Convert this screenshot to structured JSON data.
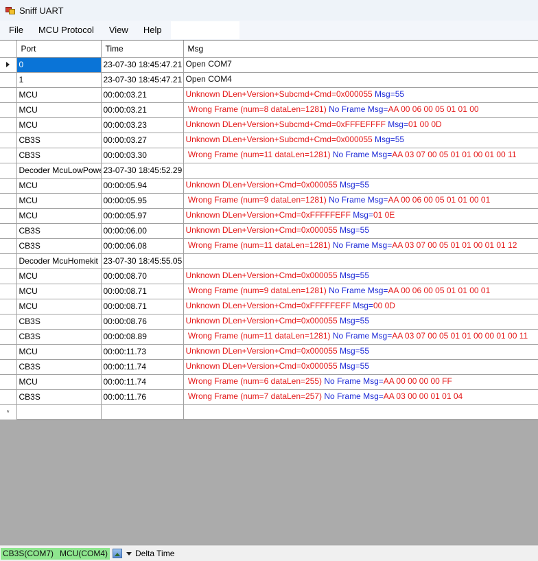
{
  "window": {
    "title": "Sniff UART"
  },
  "menu": {
    "file": "File",
    "mcu_protocol": "MCU Protocol",
    "view": "View",
    "help": "Help"
  },
  "grid": {
    "columns": {
      "port": "Port",
      "time": "Time",
      "msg": "Msg"
    },
    "rows": [
      {
        "port": "0",
        "time": "23-07-30 18:45:47.21",
        "parts": [
          {
            "text": "Open COM7",
            "color": "black"
          }
        ]
      },
      {
        "port": "1",
        "time": "23-07-30 18:45:47.21",
        "parts": [
          {
            "text": "Open COM4",
            "color": "black"
          }
        ]
      },
      {
        "port": "MCU",
        "time": "00:00:03.21",
        "parts": [
          {
            "text": "Unknown DLen+Version+Subcmd+Cmd=0x000055 ",
            "color": "red"
          },
          {
            "text": "Msg=55",
            "color": "blue"
          }
        ]
      },
      {
        "port": "MCU",
        "time": "00:00:03.21",
        "parts": [
          {
            "text": " Wrong Frame (num=8 dataLen=1281) ",
            "color": "red"
          },
          {
            "text": "No Frame Msg=",
            "color": "blue"
          },
          {
            "text": "AA 00 06 00 05 01 01 00",
            "color": "red"
          }
        ]
      },
      {
        "port": "MCU",
        "time": "00:00:03.23",
        "parts": [
          {
            "text": "Unknown DLen+Version+Subcmd+Cmd=0xFFFEFFFF ",
            "color": "red"
          },
          {
            "text": "Msg=",
            "color": "blue"
          },
          {
            "text": "01 00 0D",
            "color": "red"
          }
        ]
      },
      {
        "port": "CB3S",
        "time": "00:00:03.27",
        "parts": [
          {
            "text": "Unknown DLen+Version+Subcmd+Cmd=0x000055 ",
            "color": "red"
          },
          {
            "text": "Msg=55",
            "color": "blue"
          }
        ]
      },
      {
        "port": "CB3S",
        "time": "00:00:03.30",
        "parts": [
          {
            "text": " Wrong Frame (num=11 dataLen=1281) ",
            "color": "red"
          },
          {
            "text": "No Frame Msg=",
            "color": "blue"
          },
          {
            "text": "AA 03 07 00 05 01 01 00 01 00 11",
            "color": "red"
          }
        ]
      },
      {
        "port": "Decoder McuLowPower",
        "time": "23-07-30 18:45:52.29",
        "parts": []
      },
      {
        "port": "MCU",
        "time": "00:00:05.94",
        "parts": [
          {
            "text": "Unknown DLen+Version+Cmd=0x000055 ",
            "color": "red"
          },
          {
            "text": "Msg=55",
            "color": "blue"
          }
        ]
      },
      {
        "port": "MCU",
        "time": "00:00:05.95",
        "parts": [
          {
            "text": " Wrong Frame (num=9 dataLen=1281) ",
            "color": "red"
          },
          {
            "text": "No Frame Msg=",
            "color": "blue"
          },
          {
            "text": "AA 00 06 00 05 01 01 00 01",
            "color": "red"
          }
        ]
      },
      {
        "port": "MCU",
        "time": "00:00:05.97",
        "parts": [
          {
            "text": "Unknown DLen+Version+Cmd=0xFFFFFEFF ",
            "color": "red"
          },
          {
            "text": "Msg=",
            "color": "blue"
          },
          {
            "text": "01 0E",
            "color": "red"
          }
        ]
      },
      {
        "port": "CB3S",
        "time": "00:00:06.00",
        "parts": [
          {
            "text": "Unknown DLen+Version+Cmd=0x000055 ",
            "color": "red"
          },
          {
            "text": "Msg=55",
            "color": "blue"
          }
        ]
      },
      {
        "port": "CB3S",
        "time": "00:00:06.08",
        "parts": [
          {
            "text": " Wrong Frame (num=11 dataLen=1281) ",
            "color": "red"
          },
          {
            "text": "No Frame Msg=",
            "color": "blue"
          },
          {
            "text": "AA 03 07 00 05 01 01 00 01 01 12",
            "color": "red"
          }
        ]
      },
      {
        "port": "Decoder McuHomekit",
        "time": "23-07-30 18:45:55.05",
        "parts": []
      },
      {
        "port": "MCU",
        "time": "00:00:08.70",
        "parts": [
          {
            "text": "Unknown DLen+Version+Cmd=0x000055 ",
            "color": "red"
          },
          {
            "text": "Msg=55",
            "color": "blue"
          }
        ]
      },
      {
        "port": "MCU",
        "time": "00:00:08.71",
        "parts": [
          {
            "text": " Wrong Frame (num=9 dataLen=1281) ",
            "color": "red"
          },
          {
            "text": "No Frame Msg=",
            "color": "blue"
          },
          {
            "text": "AA 00 06 00 05 01 01 00 01",
            "color": "red"
          }
        ]
      },
      {
        "port": "MCU",
        "time": "00:00:08.71",
        "parts": [
          {
            "text": "Unknown DLen+Version+Cmd=0xFFFFFEFF ",
            "color": "red"
          },
          {
            "text": "Msg=",
            "color": "blue"
          },
          {
            "text": "00 0D",
            "color": "red"
          }
        ]
      },
      {
        "port": "CB3S",
        "time": "00:00:08.76",
        "parts": [
          {
            "text": "Unknown DLen+Version+Cmd=0x000055 ",
            "color": "red"
          },
          {
            "text": "Msg=55",
            "color": "blue"
          }
        ]
      },
      {
        "port": "CB3S",
        "time": "00:00:08.89",
        "parts": [
          {
            "text": " Wrong Frame (num=11 dataLen=1281) ",
            "color": "red"
          },
          {
            "text": "No Frame Msg=",
            "color": "blue"
          },
          {
            "text": "AA 03 07 00 05 01 01 00 00 01 00 11",
            "color": "red"
          }
        ]
      },
      {
        "port": "MCU",
        "time": "00:00:11.73",
        "parts": [
          {
            "text": "Unknown DLen+Version+Cmd=0x000055 ",
            "color": "red"
          },
          {
            "text": "Msg=55",
            "color": "blue"
          }
        ]
      },
      {
        "port": "CB3S",
        "time": "00:00:11.74",
        "parts": [
          {
            "text": "Unknown DLen+Version+Cmd=0x000055 ",
            "color": "red"
          },
          {
            "text": "Msg=55",
            "color": "blue"
          }
        ]
      },
      {
        "port": "MCU",
        "time": "00:00:11.74",
        "parts": [
          {
            "text": " Wrong Frame (num=6 dataLen=255) ",
            "color": "red"
          },
          {
            "text": "No Frame Msg=",
            "color": "blue"
          },
          {
            "text": "AA 00 00 00 00 FF",
            "color": "red"
          }
        ]
      },
      {
        "port": "CB3S",
        "time": "00:00:11.76",
        "parts": [
          {
            "text": " Wrong Frame (num=7 dataLen=257) ",
            "color": "red"
          },
          {
            "text": "No Frame Msg=",
            "color": "blue"
          },
          {
            "text": "AA 03 00 00 01 01 04",
            "color": "red"
          }
        ]
      }
    ],
    "new_row_marker": "*"
  },
  "status": {
    "port1": "CB3S(COM7)",
    "port2": "MCU(COM4)",
    "delta_time": "Delta Time",
    "accent_color": "#8ee68e"
  }
}
